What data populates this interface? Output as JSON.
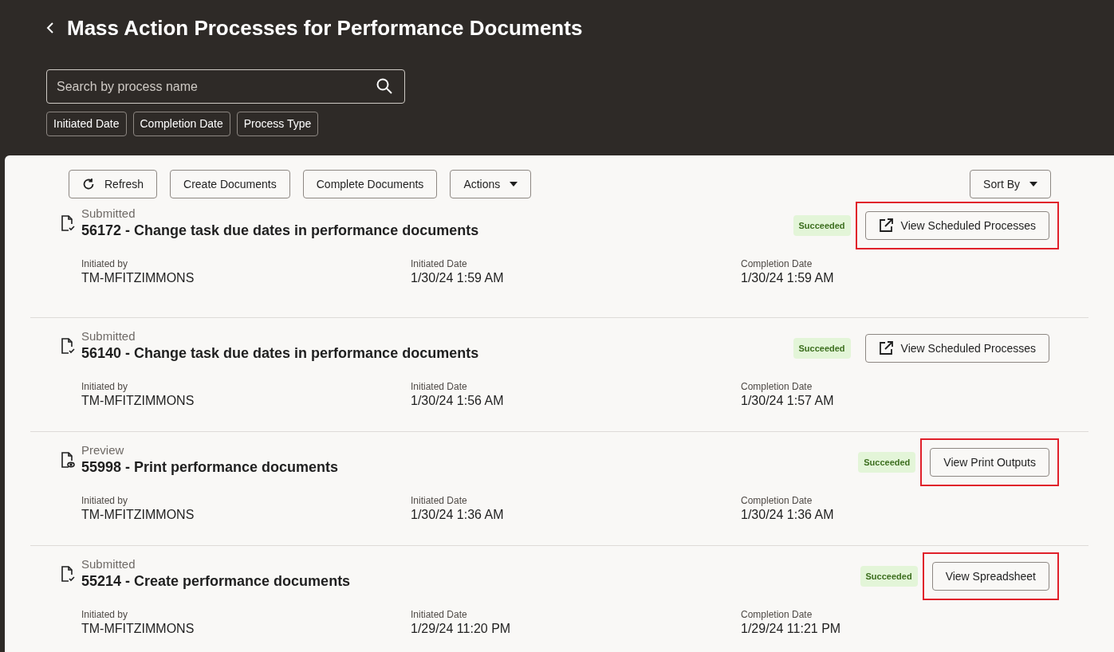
{
  "header": {
    "title": "Mass Action Processes for Performance Documents",
    "search": {
      "placeholder": "Search by process name"
    },
    "filters": [
      "Initiated Date",
      "Completion Date",
      "Process Type"
    ]
  },
  "toolbar": {
    "buttons": [
      {
        "label": "Refresh",
        "kind": "refresh"
      },
      {
        "label": "Create Documents",
        "kind": "plain"
      },
      {
        "label": "Complete Documents",
        "kind": "plain"
      },
      {
        "label": "Actions",
        "kind": "menu"
      }
    ],
    "sort": {
      "label": "Sort By"
    }
  },
  "processes": [
    {
      "mode": "Submitted",
      "kind": "submitted",
      "title": "56172 - Change task due dates in performance documents",
      "status": "Succeeded",
      "action": {
        "label": "View Scheduled Processes",
        "external": true,
        "highlighted": true
      },
      "fields": [
        {
          "label": "Initiated by",
          "value": "TM-MFITZIMMONS"
        },
        {
          "label": "Initiated Date",
          "value": "1/30/24 1:59 AM"
        },
        {
          "label": "Completion Date",
          "value": "1/30/24 1:59 AM"
        }
      ]
    },
    {
      "mode": "Submitted",
      "kind": "submitted",
      "title": "56140 - Change task due dates in performance documents",
      "status": "Succeeded",
      "action": {
        "label": "View Scheduled Processes",
        "external": true,
        "highlighted": false
      },
      "fields": [
        {
          "label": "Initiated by",
          "value": "TM-MFITZIMMONS"
        },
        {
          "label": "Initiated Date",
          "value": "1/30/24 1:56 AM"
        },
        {
          "label": "Completion Date",
          "value": "1/30/24 1:57 AM"
        }
      ]
    },
    {
      "mode": "Preview",
      "kind": "preview",
      "title": "55998 - Print performance documents",
      "status": "Succeeded",
      "action": {
        "label": "View Print Outputs",
        "external": false,
        "highlighted": true
      },
      "fields": [
        {
          "label": "Initiated by",
          "value": "TM-MFITZIMMONS"
        },
        {
          "label": "Initiated Date",
          "value": "1/30/24 1:36 AM"
        },
        {
          "label": "Completion Date",
          "value": "1/30/24 1:36 AM"
        }
      ]
    },
    {
      "mode": "Submitted",
      "kind": "submitted",
      "title": "55214 - Create performance documents",
      "status": "Succeeded",
      "action": {
        "label": "View Spreadsheet",
        "external": false,
        "highlighted": true
      },
      "fields": [
        {
          "label": "Initiated by",
          "value": "TM-MFITZIMMONS"
        },
        {
          "label": "Initiated Date",
          "value": "1/29/24 11:20 PM"
        },
        {
          "label": "Completion Date",
          "value": "1/29/24 11:21 PM"
        }
      ]
    }
  ]
}
